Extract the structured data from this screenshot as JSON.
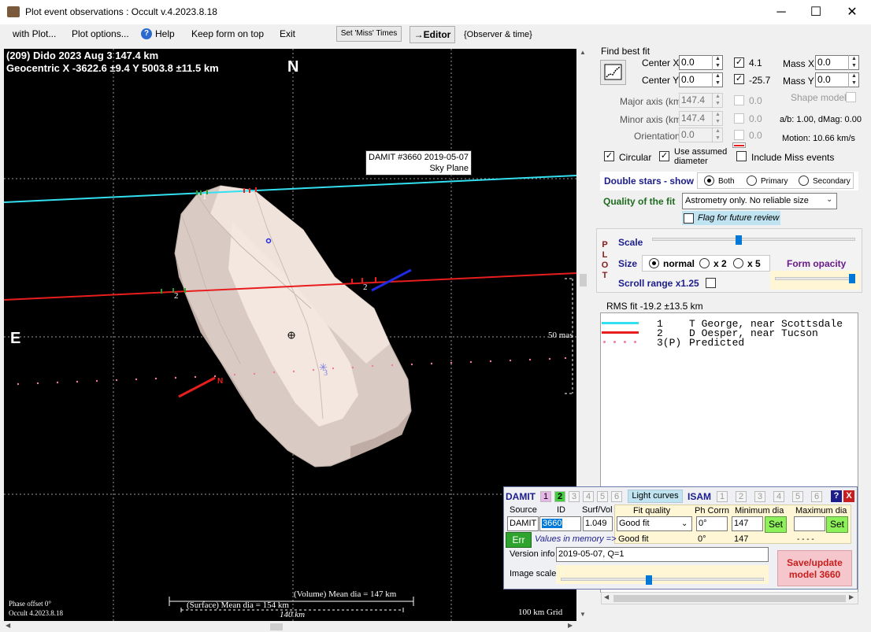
{
  "window": {
    "title": "Plot event observations : Occult v.4.2023.8.18",
    "minimize": "─",
    "maximize": "☐",
    "close": "✕"
  },
  "menu": {
    "with_plot": "with Plot...",
    "plot_options": "Plot options...",
    "help": "Help",
    "keep_on_top": "Keep form on top",
    "exit": "Exit",
    "set_miss_times": "Set 'Miss' Times",
    "editor": "→Editor",
    "observer_time": "{Observer & time}"
  },
  "plot": {
    "header_line1": "(209) Dido  2023 Aug 3   147.4 km",
    "header_line2": "Geocentric  X  -3622.6 ±9.4  Y 5003.8 ±11.5 km",
    "north": "N",
    "east": "E",
    "damit_label_1": "DAMIT #3660 2019-05-07",
    "damit_label_2": "Sky Plane",
    "scale_label": "50 mas",
    "chord_1": "1",
    "chord_2": "2",
    "chord_2b": "2",
    "predicted": "3",
    "n_marker": "N",
    "phase_offset": "Phase offset 0°",
    "version": "Occult 4.2023.8.18",
    "surface_dia": "(Surface) Mean dia = 154 km",
    "volume_dia": "(Volume) Mean dia = 147 km",
    "width_km": "140 km",
    "grid": "100 km Grid"
  },
  "fit": {
    "title": "Find best fit",
    "center_x_label": "Center X",
    "center_x": "0.0",
    "center_y_label": "Center Y",
    "center_y": "0.0",
    "cx_check_val": "4.1",
    "cy_check_val": "-25.7",
    "mass_x_label": "Mass X",
    "mass_x": "0.0",
    "mass_y_label": "Mass Y",
    "mass_y": "0.0",
    "major_label": "Major axis (km)",
    "major": "147.4",
    "major_val": "0.0",
    "minor_label": "Minor axis (km)",
    "minor": "147.4",
    "minor_val": "0.0",
    "orient_label": "Orientation",
    "orient": "0.0",
    "orient_val": "0.0",
    "shape_model": "Shape model",
    "ab_dmag": "a/b: 1.00, dMag: 0.00",
    "motion": "Motion: 10.66 km/s",
    "circular": "Circular",
    "use_assumed_1": "Use assumed",
    "use_assumed_2": "diameter",
    "include_miss": "Include Miss events",
    "double_stars": "Double stars - show",
    "both": "Both",
    "primary": "Primary",
    "secondary": "Secondary",
    "quality_label": "Quality of the fit",
    "quality_value": "Astrometry only. No reliable size",
    "flag_review": "Flag for future review"
  },
  "plotctl": {
    "plot_letters": [
      "P",
      "L",
      "O",
      "T"
    ],
    "scale": "Scale",
    "size": "Size",
    "normal": "normal",
    "x2": "x 2",
    "x5": "x 5",
    "form_opacity": "Form opacity",
    "scroll_range": "Scroll range x1.25",
    "rms_fit": "RMS fit -19.2 ±13.5 km"
  },
  "legend": [
    {
      "num": "1",
      "text": "T George, near Scottsdale",
      "color": "#33e0f0"
    },
    {
      "num": "2",
      "text": "D Oesper, near Tucson",
      "color": "#e81e1e"
    },
    {
      "num": "3(P)",
      "text": "Predicted",
      "color": "#f07c9a"
    }
  ],
  "damit": {
    "title": "DAMIT",
    "nums": [
      "1",
      "2",
      "3",
      "4",
      "5",
      "6"
    ],
    "light_curves": "Light curves",
    "isam": "ISAM",
    "isam_nums": [
      "1",
      "2",
      "3",
      "4",
      "5",
      "6"
    ],
    "help": "?",
    "close": "X",
    "source_hdr": "Source",
    "id_hdr": "ID",
    "surf_hdr": "Surf/Vol",
    "fitq_hdr": "Fit quality",
    "phcorr_hdr": "Ph Corrn",
    "mindia_hdr": "Minimum dia",
    "maxdia_hdr": "Maximum dia",
    "source": "DAMIT",
    "id": "3660",
    "surf": "1.049",
    "fitq": "Good fit",
    "phcorr": "0°",
    "mindia": "147",
    "set": "Set",
    "set2": "Set",
    "err": "Err",
    "in_memory": "Values in memory =>",
    "mem_fitq": "Good fit",
    "mem_ph": "0°",
    "mem_min": "147",
    "mem_max": "- - - -",
    "version_label": "Version info",
    "version": "2019-05-07, Q=1",
    "image_scale": "Image scale",
    "save_1": "Save/update",
    "save_2": "model 3660"
  }
}
